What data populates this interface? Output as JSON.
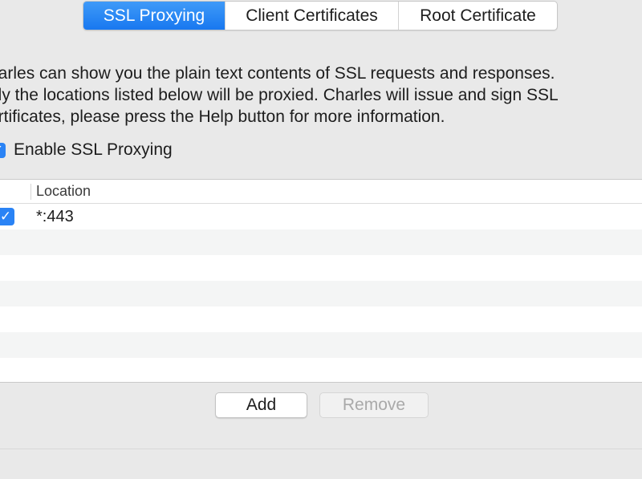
{
  "tabs": [
    {
      "label": "SSL Proxying",
      "active": true
    },
    {
      "label": "Client Certificates",
      "active": false
    },
    {
      "label": "Root Certificate",
      "active": false
    }
  ],
  "description": {
    "line1": "harles can show you the plain text contents of SSL requests and responses.",
    "line2": "nly the locations listed below will be proxied. Charles will issue and sign SSL",
    "line3": "ertificates, please press the Help button for more information."
  },
  "enable_ssl": {
    "label": "Enable SSL Proxying",
    "checked": true
  },
  "table": {
    "columns": [
      "Location"
    ],
    "rows": [
      {
        "enabled": true,
        "location": "*:443"
      }
    ]
  },
  "buttons": {
    "add_label": "Add",
    "remove_label": "Remove",
    "remove_enabled": false
  },
  "colors": {
    "accent": "#1878f0",
    "window_bg": "#e9e9e9",
    "alt_row": "#f4f5f5",
    "disabled_text": "#a9a9a9"
  },
  "icons": {
    "checkbox": "checkmark-icon"
  }
}
